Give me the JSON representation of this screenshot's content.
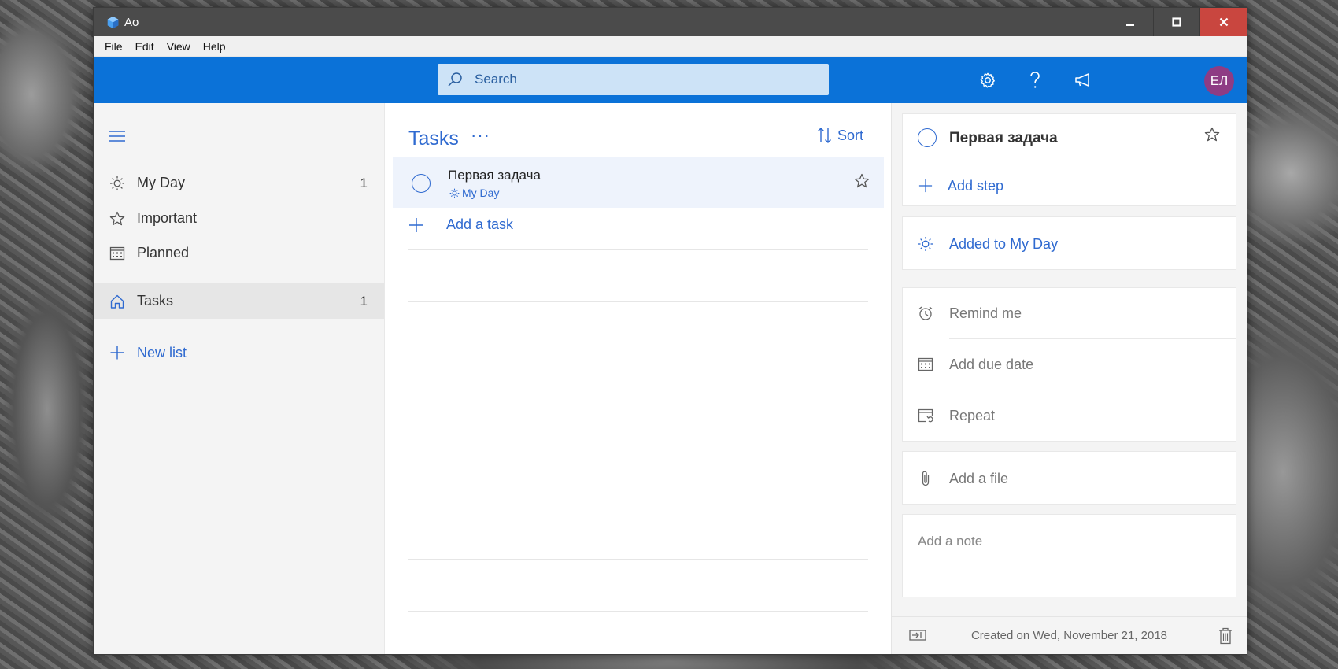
{
  "window": {
    "title": "Ao"
  },
  "menu": [
    "File",
    "Edit",
    "View",
    "Help"
  ],
  "search": {
    "placeholder": "Search"
  },
  "user": {
    "initials": "ЕЛ"
  },
  "colors": {
    "accent": "#0b72d8",
    "link": "#2f6ad0",
    "avatar": "#8e3c84",
    "close": "#c9463f"
  },
  "sidebar": {
    "items": [
      {
        "icon": "sun-icon",
        "label": "My Day",
        "count": "1"
      },
      {
        "icon": "star-icon",
        "label": "Important",
        "count": ""
      },
      {
        "icon": "calendar-icon",
        "label": "Planned",
        "count": ""
      },
      {
        "icon": "home-icon",
        "label": "Tasks",
        "count": "1",
        "selected": true
      }
    ],
    "new_list": "New list"
  },
  "tasklist": {
    "title": "Tasks",
    "more": "···",
    "sort_label": "Sort",
    "tasks": [
      {
        "title": "Первая задача",
        "subtitle": "My Day",
        "starred": false
      }
    ],
    "add_task": "Add a task"
  },
  "detail": {
    "title": "Первая задача",
    "add_step": "Add step",
    "my_day": "Added to My Day",
    "remind": "Remind me",
    "due": "Add due date",
    "repeat": "Repeat",
    "file": "Add a file",
    "note_placeholder": "Add a note",
    "created": "Created on Wed, November 21, 2018"
  }
}
